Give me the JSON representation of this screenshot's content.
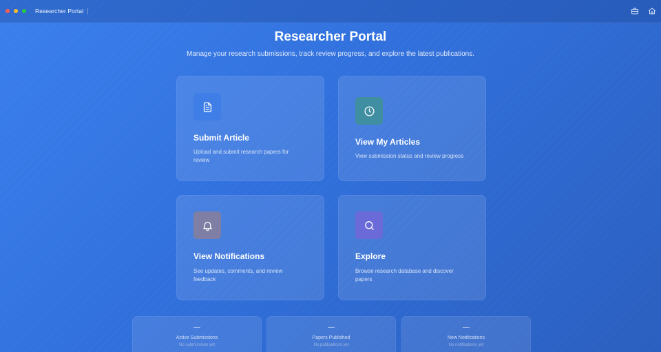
{
  "window": {
    "title": "Researcher Portal",
    "controls": [
      "close",
      "minimize",
      "maximize"
    ]
  },
  "toolbar": {
    "icons": [
      "briefcase-icon",
      "home-icon"
    ]
  },
  "header": {
    "title": "Researcher Portal",
    "subtitle": "Manage your research submissions, track review progress, and explore the latest publications."
  },
  "cards": [
    {
      "title": "Submit Article",
      "description": "Upload and submit research papers for review",
      "icon": "document-icon",
      "icon_color": "#3f7ee6"
    },
    {
      "title": "View My Articles",
      "description": "View submission status and review progress",
      "icon": "clock-icon",
      "icon_color": "#3f8ea1"
    },
    {
      "title": "View Notifications",
      "description": "See updates, comments, and review feedback",
      "icon": "bell-icon",
      "icon_color": "#7f7fa6"
    },
    {
      "title": "Explore",
      "description": "Browse research database and discover papers",
      "icon": "search-icon",
      "icon_color": "#6a6ad9"
    }
  ],
  "stats": [
    {
      "value": "—",
      "label": "Active Submissions",
      "sub": "No submissions yet"
    },
    {
      "value": "—",
      "label": "Papers Published",
      "sub": "No publications yet"
    },
    {
      "value": "—",
      "label": "New Notifications",
      "sub": "No notifications yet"
    }
  ]
}
